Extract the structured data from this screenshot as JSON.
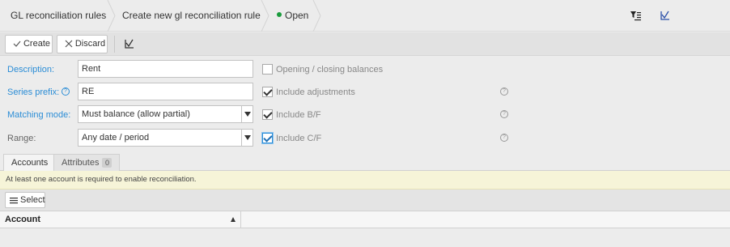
{
  "breadcrumb": {
    "items": [
      "GL reconciliation rules",
      "Create new gl reconciliation rule"
    ],
    "status": "Open",
    "status_color": "#1a9b3c"
  },
  "toolbar": {
    "create_label": "Create",
    "discard_label": "Discard"
  },
  "form": {
    "description_label": "Description:",
    "description_value": "Rent",
    "series_prefix_label": "Series prefix:",
    "series_prefix_value": "RE",
    "matching_mode_label": "Matching mode:",
    "matching_mode_value": "Must balance (allow partial)",
    "range_label": "Range:",
    "range_value": "Any date / period",
    "opening_closing_label": "Opening / closing balances",
    "opening_closing_checked": false,
    "include_adjustments_label": "Include adjustments",
    "include_adjustments_checked": true,
    "include_bf_label": "Include B/F",
    "include_bf_checked": true,
    "include_cf_label": "Include C/F",
    "include_cf_checked": true
  },
  "tabs": [
    {
      "label": "Accounts",
      "active": true
    },
    {
      "label": "Attributes",
      "badge": "0",
      "active": false
    }
  ],
  "notice": "At least one account is required to enable reconciliation.",
  "accounts": {
    "select_label": "Select",
    "columns": [
      "Account"
    ]
  },
  "icons": {
    "filter": "filter-list-icon",
    "sign_off": "sign-off-icon",
    "help": "help-circle-icon"
  },
  "colors": {
    "link_label": "#2b8dd6",
    "notice_bg": "#f6f4d8"
  }
}
